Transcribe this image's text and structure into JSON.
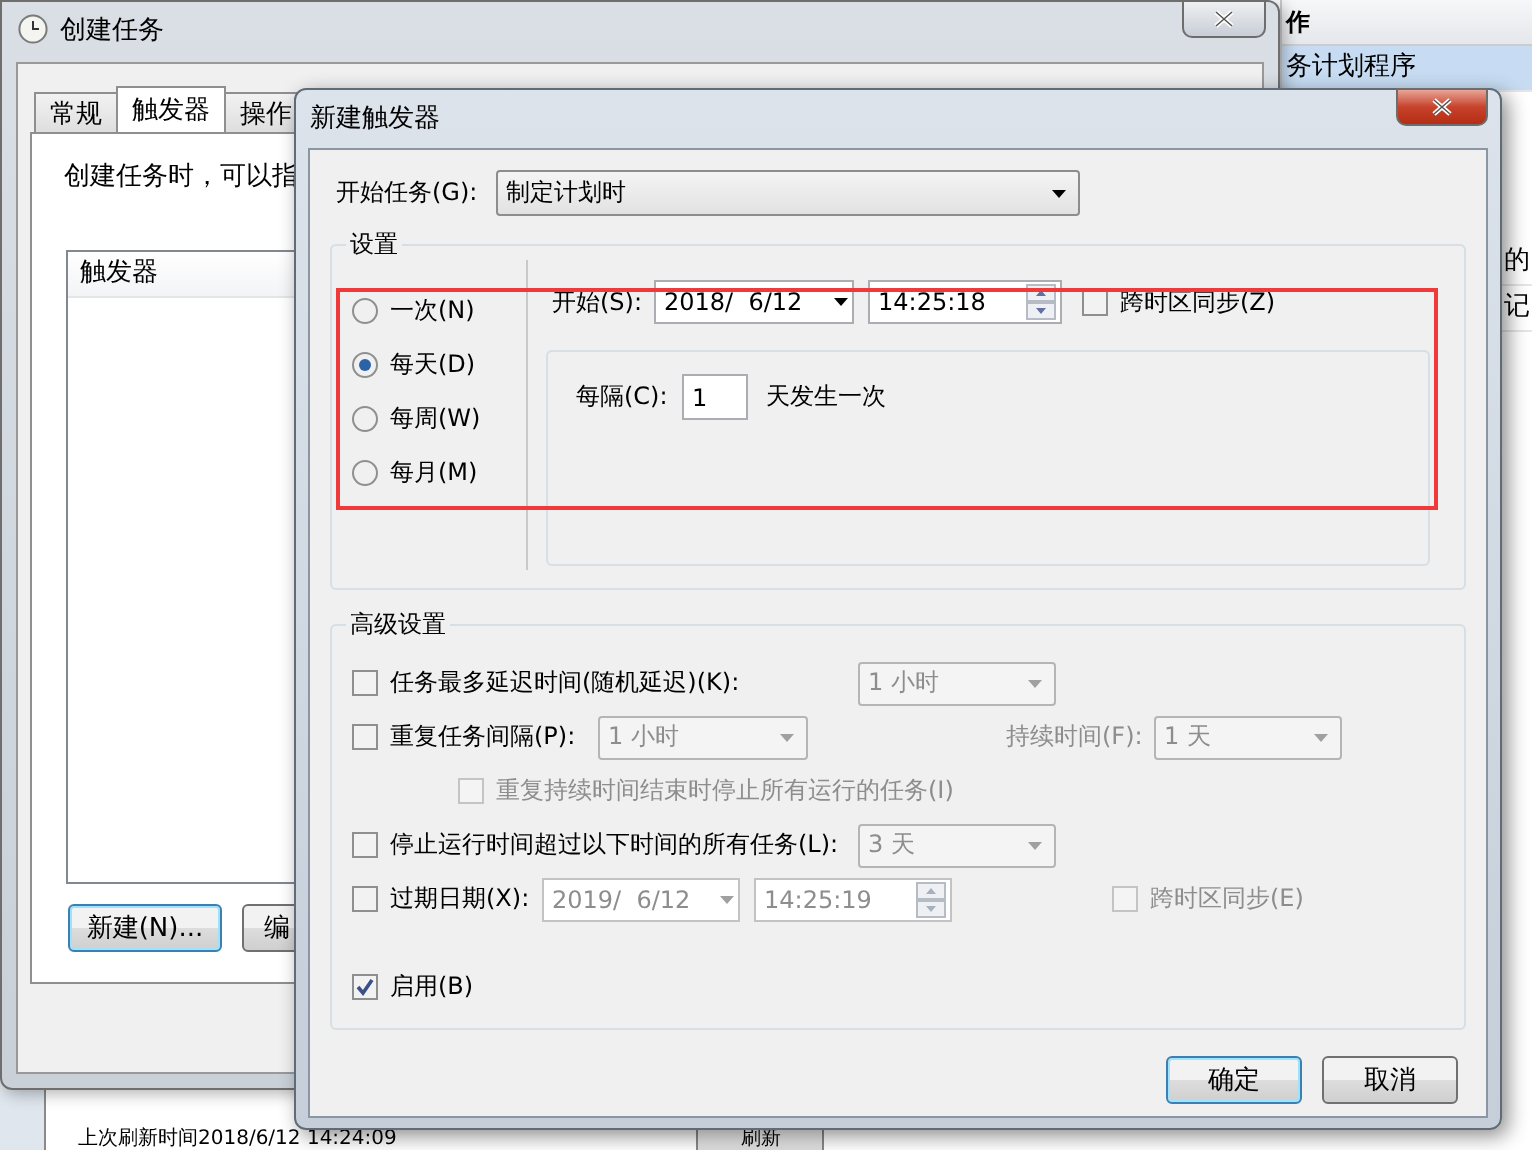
{
  "back_window": {
    "pane_header": "作",
    "pane_items": [
      {
        "label": "务计划程序",
        "selected": true
      },
      {
        "label": "的",
        "selected": false
      },
      {
        "label": "记",
        "selected": false
      }
    ],
    "status_text": "上次刷新时间2018/6/12 14:24:09",
    "refresh_button": "刷新"
  },
  "task_window": {
    "title": "创建任务",
    "tabs": [
      {
        "label": "常规",
        "selected": false
      },
      {
        "label": "触发器",
        "selected": true
      },
      {
        "label": "操作",
        "selected": false
      }
    ],
    "description": "创建任务时，可以指",
    "list": {
      "columns": [
        "触发器"
      ]
    },
    "buttons": [
      {
        "label": "新建(N)...",
        "default": true
      },
      {
        "label": "编",
        "default": false
      }
    ]
  },
  "dialog": {
    "title": "新建触发器",
    "begin": {
      "label": "开始任务(G):",
      "value": "制定计划时"
    },
    "settings": {
      "title": "设置",
      "schedule": [
        {
          "label": "一次(N)",
          "selected": false
        },
        {
          "label": "每天(D)",
          "selected": true
        },
        {
          "label": "每周(W)",
          "selected": false
        },
        {
          "label": "每月(M)",
          "selected": false
        }
      ],
      "start": {
        "label": "开始(S):",
        "date": "2018/  6/12",
        "time": "14:25:18"
      },
      "sync": {
        "label": "跨时区同步(Z)",
        "checked": false
      },
      "recur": {
        "label": "每隔(C):",
        "value": "1",
        "unit": "天发生一次"
      }
    },
    "advanced": {
      "title": "高级设置",
      "rows": [
        {
          "kind": "select",
          "label": "任务最多延迟时间(随机延迟)(K):",
          "checked": false,
          "value": "1 小时",
          "disabled": true
        },
        {
          "kind": "repeat",
          "label": "重复任务间隔(P):",
          "checked": false,
          "value": "1 小时",
          "duration_label": "持续时间(F):",
          "duration": "1 天",
          "disabled": true
        },
        {
          "kind": "sub",
          "label": "重复持续时间结束时停止所有运行的任务(I)",
          "checked": false,
          "disabled": true
        },
        {
          "kind": "select",
          "label": "停止运行时间超过以下时间的所有任务(L):",
          "checked": false,
          "value": "3 天",
          "disabled": true
        },
        {
          "kind": "expire",
          "label": "过期日期(X):",
          "checked": false,
          "date": "2019/  6/12",
          "time": "14:25:19",
          "sync": "跨时区同步(E)",
          "sync_checked": false,
          "disabled": true
        },
        {
          "kind": "plain",
          "label": "启用(B)",
          "checked": true
        }
      ]
    },
    "buttons": [
      {
        "label": "确定",
        "default": true
      },
      {
        "label": "取消",
        "default": false
      }
    ]
  }
}
